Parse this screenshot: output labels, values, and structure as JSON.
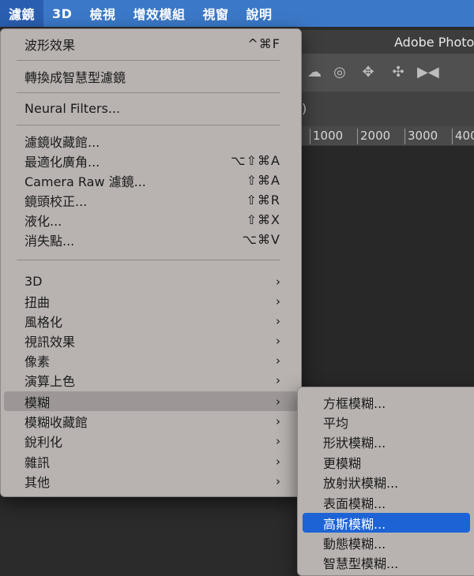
{
  "menubar": {
    "items": [
      {
        "label": "濾鏡",
        "active": true
      },
      {
        "label": "3D"
      },
      {
        "label": "檢視"
      },
      {
        "label": "增效模組"
      },
      {
        "label": "視窗"
      },
      {
        "label": "說明"
      }
    ]
  },
  "app": {
    "title": "Adobe Photo",
    "tab_text": ")",
    "ruler": [
      "1000",
      "2000",
      "3000",
      "400"
    ],
    "toolbar_icons": [
      "orbit-3d-icon",
      "roll-3d-icon",
      "pan-3d-icon",
      "slide-3d-icon",
      "scale-3d-icon"
    ]
  },
  "filter_menu": {
    "last_filter": {
      "label": "波形效果",
      "shortcut": "^⌘F"
    },
    "smart_filters": "轉換成智慧型濾鏡",
    "neural_filters": "Neural Filters...",
    "group1": [
      {
        "label": "濾鏡收藏館...",
        "shortcut": ""
      },
      {
        "label": "最適化廣角...",
        "shortcut": "⌥⇧⌘A"
      },
      {
        "label": "Camera Raw 濾鏡...",
        "shortcut": "⇧⌘A"
      },
      {
        "label": "鏡頭校正...",
        "shortcut": "⇧⌘R"
      },
      {
        "label": "液化...",
        "shortcut": "⇧⌘X"
      },
      {
        "label": "消失點...",
        "shortcut": "⌥⌘V"
      }
    ],
    "submenus": [
      "3D",
      "扭曲",
      "風格化",
      "視訊效果",
      "像素",
      "演算上色",
      "模糊",
      "模糊收藏館",
      "銳利化",
      "雜訊",
      "其他"
    ],
    "highlighted": "模糊",
    "chevron": "›"
  },
  "blur_submenu": {
    "items": [
      "方框模糊...",
      "平均",
      "形狀模糊...",
      "更模糊",
      "放射狀模糊...",
      "表面模糊...",
      "高斯模糊...",
      "動態模糊...",
      "智慧型模糊..."
    ],
    "selected": "高斯模糊..."
  },
  "colors": {
    "menubar": "#3b78c7",
    "menu_bg": "#b8b3b1",
    "highlight": "#9c9796",
    "selection": "#1d63d5"
  }
}
